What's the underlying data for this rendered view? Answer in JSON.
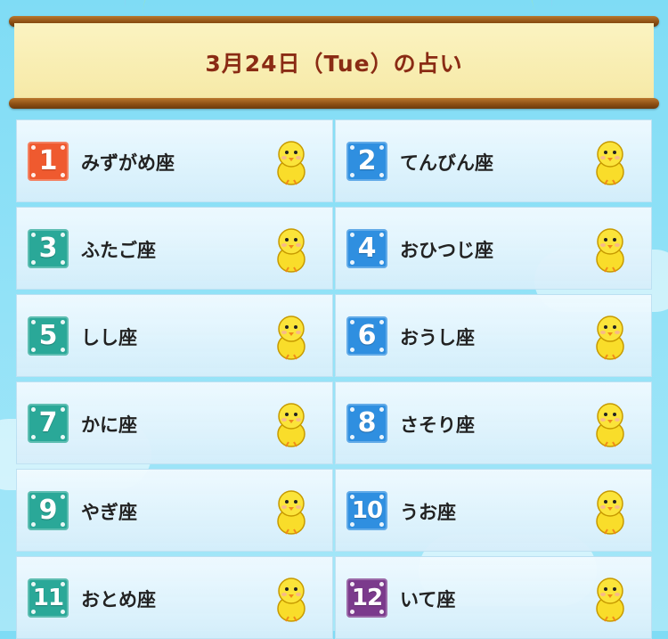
{
  "title": "3月24日（Tue）の占い",
  "colors": {
    "rank1": "#ef5a2f",
    "blue": "#2f8fe0",
    "teal": "#2aa898",
    "purple": "#7b3a8c",
    "title": "#8a2b14"
  },
  "rankings": [
    {
      "rank": "1",
      "sign": "みずがめ座",
      "icon": "aquarius-chick-icon",
      "color": "#ef5a2f"
    },
    {
      "rank": "2",
      "sign": "てんびん座",
      "icon": "libra-chick-icon",
      "color": "#2f8fe0"
    },
    {
      "rank": "3",
      "sign": "ふたご座",
      "icon": "gemini-chick-icon",
      "color": "#2aa898"
    },
    {
      "rank": "4",
      "sign": "おひつじ座",
      "icon": "aries-chick-icon",
      "color": "#2f8fe0"
    },
    {
      "rank": "5",
      "sign": "しし座",
      "icon": "leo-chick-icon",
      "color": "#2aa898"
    },
    {
      "rank": "6",
      "sign": "おうし座",
      "icon": "taurus-chick-icon",
      "color": "#2f8fe0"
    },
    {
      "rank": "7",
      "sign": "かに座",
      "icon": "cancer-chick-icon",
      "color": "#2aa898"
    },
    {
      "rank": "8",
      "sign": "さそり座",
      "icon": "scorpio-chick-icon",
      "color": "#2f8fe0"
    },
    {
      "rank": "9",
      "sign": "やぎ座",
      "icon": "capricorn-chick-icon",
      "color": "#2aa898"
    },
    {
      "rank": "10",
      "sign": "うお座",
      "icon": "pisces-chick-icon",
      "color": "#2f8fe0"
    },
    {
      "rank": "11",
      "sign": "おとめ座",
      "icon": "virgo-chick-icon",
      "color": "#2aa898"
    },
    {
      "rank": "12",
      "sign": "いて座",
      "icon": "sagittarius-chick-icon",
      "color": "#7b3a8c"
    }
  ]
}
